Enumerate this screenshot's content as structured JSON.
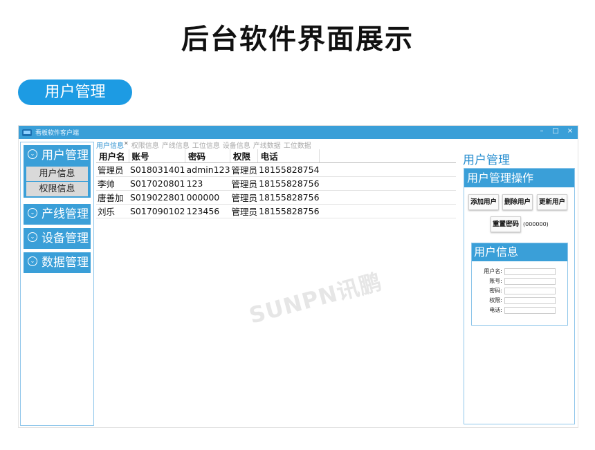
{
  "page": {
    "title": "后台软件界面展示",
    "section_label": "用户管理"
  },
  "window": {
    "app_title": "看板软件客户端",
    "controls": [
      "–",
      "□",
      "×"
    ]
  },
  "sidebar": {
    "groups": [
      {
        "label": "用户管理",
        "icon": "circle-chevron-icon",
        "items": [
          "用户信息",
          "权限信息"
        ]
      },
      {
        "label": "产线管理",
        "icon": "circle-chevron-icon"
      },
      {
        "label": "设备管理",
        "icon": "circle-chevron-icon"
      },
      {
        "label": "数据管理",
        "icon": "circle-chevron-icon"
      }
    ]
  },
  "tabs": {
    "items": [
      "用户信息",
      "权限信息",
      "产线信息",
      "工位信息",
      "设备信息",
      "产线数据",
      "工位数据"
    ],
    "active": "用户信息",
    "close_glyph": "×"
  },
  "table": {
    "columns": [
      "用户名",
      "账号",
      "密码",
      "权限",
      "电话"
    ],
    "rows": [
      [
        "管理员",
        "S018031401",
        "admin123",
        "管理员",
        "18155828754"
      ],
      [
        "李帅",
        "S017020801",
        "123",
        "管理员",
        "18155828756"
      ],
      [
        "唐善加",
        "S019022801",
        "000000",
        "管理员",
        "18155828756"
      ],
      [
        "刘乐",
        "S017090102",
        "123456",
        "管理员",
        "18155828756"
      ]
    ]
  },
  "right_panel": {
    "title": "用户管理",
    "ops_header": "用户管理操作",
    "buttons": {
      "add": "添加用户",
      "delete": "删除用户",
      "update": "更新用户",
      "reset": "重置密码"
    },
    "reset_note": "(000000)",
    "info_header": "用户信息",
    "fields": [
      "用户名:",
      "账号:",
      "密码:",
      "权限:",
      "电话:"
    ]
  },
  "watermark": "SUNPN讯鹏",
  "colors": {
    "accent": "#1d9be3",
    "panel_blue": "#3a9fd8",
    "border_blue": "#8ec6ea"
  }
}
